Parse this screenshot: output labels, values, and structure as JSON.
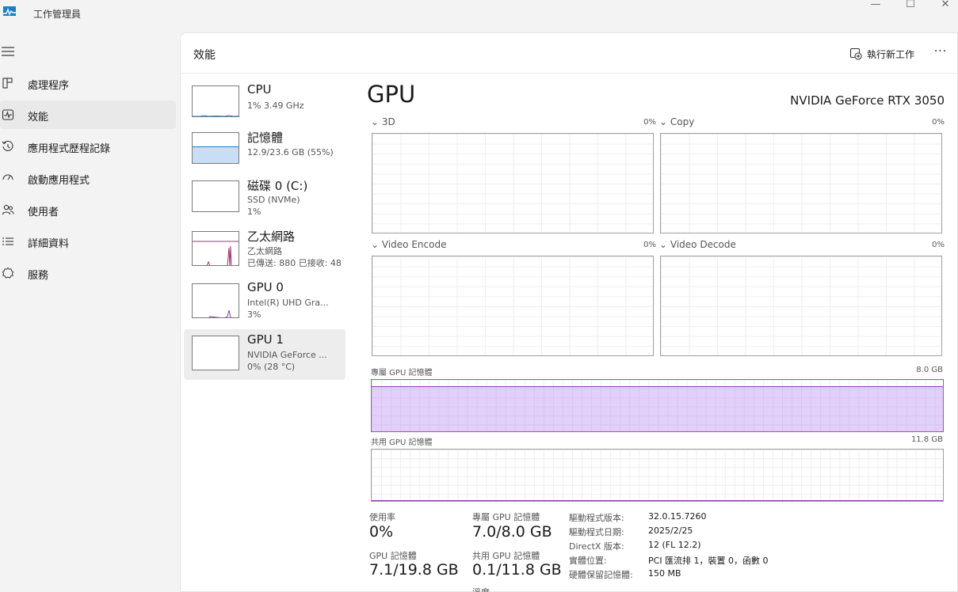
{
  "window": {
    "title": "工作管理員",
    "controls": {
      "minimize": "—",
      "maximize": "☐",
      "close": "✕"
    }
  },
  "nav": {
    "items": [
      {
        "label": "處理程序",
        "icon": "processes-icon",
        "active": false
      },
      {
        "label": "效能",
        "icon": "performance-icon",
        "active": true
      },
      {
        "label": "應用程式歷程記錄",
        "icon": "history-icon",
        "active": false
      },
      {
        "label": "啟動應用程式",
        "icon": "startup-icon",
        "active": false
      },
      {
        "label": "使用者",
        "icon": "users-icon",
        "active": false
      },
      {
        "label": "詳細資料",
        "icon": "details-icon",
        "active": false
      },
      {
        "label": "服務",
        "icon": "services-icon",
        "active": false
      }
    ]
  },
  "header": {
    "title": "效能",
    "run_task": "執行新工作",
    "more": "···"
  },
  "devices": [
    {
      "name": "CPU",
      "sub1": "1% 3.49 GHz",
      "sub2": "",
      "usage": 0.01,
      "color": "#1a7fc4"
    },
    {
      "name": "記憶體",
      "sub1": "12.9/23.6 GB (55%)",
      "sub2": "",
      "usage": 0.55,
      "color": "#1a7fc4"
    },
    {
      "name": "磁碟 0 (C:)",
      "sub1": "SSD (NVMe)",
      "sub2": "1%",
      "usage": 0.01,
      "color": "#4a9a2a"
    },
    {
      "name": "乙太網路",
      "sub1": "乙太網路",
      "sub2": "已傳送: 880 已接收: 48",
      "usage": 0.0,
      "color": "#a7336f"
    },
    {
      "name": "GPU 0",
      "sub1": "Intel(R) UHD Gra...",
      "sub2": "3%",
      "usage": 0.03,
      "color": "#8a3ea8"
    },
    {
      "name": "GPU 1",
      "sub1": "NVIDIA GeForce ...",
      "sub2": "0% (28 °C)",
      "usage": 0.0,
      "color": "#8a3ea8"
    }
  ],
  "detail": {
    "title": "GPU",
    "model": "NVIDIA GeForce RTX 3050",
    "engines": [
      {
        "label": "3D",
        "pct": "0%"
      },
      {
        "label": "Copy",
        "pct": "0%"
      },
      {
        "label": "Video Encode",
        "pct": "0%"
      },
      {
        "label": "Video Decode",
        "pct": "0%"
      }
    ],
    "dedicated": {
      "label": "專屬 GPU 記憶體",
      "max": "8.0 GB",
      "fraction": 0.875
    },
    "shared": {
      "label": "共用 GPU 記憶體",
      "max": "11.8 GB",
      "fraction": 0.0085
    },
    "stats": {
      "utilization_label": "使用率",
      "utilization_value": "0%",
      "gpu_mem_label": "GPU 記憶體",
      "gpu_mem_value": "7.1/19.8 GB",
      "dedicated_label": "專屬 GPU 記憶體",
      "dedicated_value": "7.0/8.0 GB",
      "shared_label": "共用 GPU 記憶體",
      "shared_value": "0.1/11.8 GB",
      "cut_label": "溫度"
    },
    "info": [
      {
        "k": "驅動程式版本:",
        "v": "32.0.15.7260"
      },
      {
        "k": "驅動程式日期:",
        "v": "2025/2/25"
      },
      {
        "k": "DirectX 版本:",
        "v": "12 (FL 12.2)"
      },
      {
        "k": "實體位置:",
        "v": "PCI 匯流排 1，裝置 0，函數 0"
      },
      {
        "k": "硬體保留記憶體:",
        "v": "150 MB"
      }
    ]
  },
  "colors": {
    "gpu_accent": "#8a3ea8",
    "mem_fill": "#d8c2f5",
    "net_accent": "#a7336f",
    "cpu_accent": "#1a7fc4"
  }
}
